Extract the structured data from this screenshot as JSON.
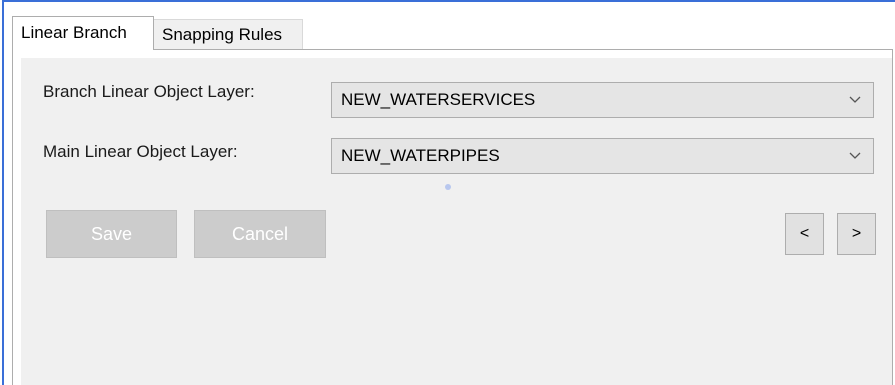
{
  "tabs": [
    {
      "label": "Linear Branch",
      "active": true
    },
    {
      "label": "Snapping Rules",
      "active": false
    }
  ],
  "form": {
    "branch_label": "Branch Linear Object Layer:",
    "branch_value": "NEW_WATERSERVICES",
    "main_label": "Main Linear Object Layer:",
    "main_value": "NEW_WATERPIPES"
  },
  "buttons": {
    "save": "Save",
    "cancel": "Cancel",
    "prev": "<",
    "next": ">"
  },
  "icons": {
    "dropdown": "chevron-down-icon"
  },
  "colors": {
    "window_border": "#3a6fd8",
    "panel_bg": "#f0f0f0",
    "disabled_button": "#cccccc"
  }
}
